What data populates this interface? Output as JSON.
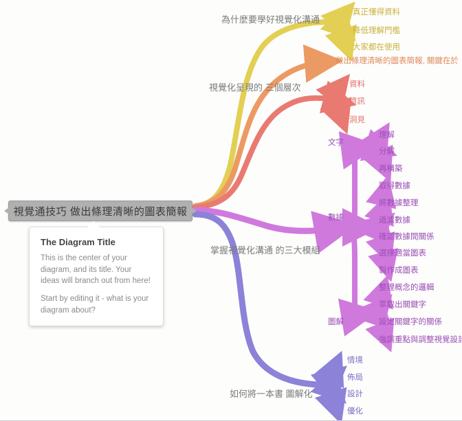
{
  "app": {
    "canvas_name": "mindmap-canvas",
    "background": "#fdfdfc"
  },
  "root": {
    "label": "視覺通技巧 做出條理清晰的圖表簡報",
    "color": "#b0b0b0"
  },
  "info_card": {
    "title": "The Diagram Title",
    "paragraph1": "This is the center of your diagram, and its title. Your ideas will branch out from here!",
    "paragraph2": "Start by editing it - what is your diagram about?"
  },
  "colors": {
    "yellow": "#e3cf53",
    "orange": "#ec9a64",
    "red": "#e97a72",
    "purple": "#cf79dd",
    "violet": "#8c82d8",
    "root_grey": "#b0b0b0"
  },
  "branches": [
    {
      "id": "why-visual-communication",
      "label": "為什麼要學好視覺化溝通",
      "color": "#e3cf53",
      "text_color": "#c9b23c",
      "children": [
        {
          "label": "真正懂得資料"
        },
        {
          "label": "降低理解門檻"
        },
        {
          "label": "大家都在使用"
        }
      ]
    },
    {
      "id": "clear-chart-key",
      "label": "做出條理清晰的圖表簡報, 關鍵在於「",
      "color": "#ec9a64",
      "text_color": "#e0885a",
      "children": []
    },
    {
      "id": "three-levels",
      "label": "視覺化呈現的 三個層次",
      "color": "#e97a72",
      "text_color": "#e0706a",
      "children": [
        {
          "label": "資料"
        },
        {
          "label": "資訊"
        },
        {
          "label": "洞見"
        }
      ]
    },
    {
      "id": "three-modules",
      "label": "掌握視覺化溝通 的三大模組",
      "color": "#cf79dd",
      "text_color": "#9a4fb5",
      "children": [
        {
          "label": "文字",
          "children": [
            {
              "label": "理解"
            },
            {
              "label": "分解"
            },
            {
              "label": "再構築"
            }
          ]
        },
        {
          "label": "數據",
          "children": [
            {
              "label": "取得數據"
            },
            {
              "label": "將數據整理"
            },
            {
              "label": "過濾數據"
            },
            {
              "label": "確認數據間關係"
            },
            {
              "label": "選擇適當圖表"
            },
            {
              "label": "製作成圖表"
            }
          ]
        },
        {
          "label": "圖解",
          "children": [
            {
              "label": "整理概念的邏輯"
            },
            {
              "label": "萃取出關鍵字"
            },
            {
              "label": "設定關鍵字的關係"
            },
            {
              "label": "強調重點與調整視覺設計"
            }
          ]
        }
      ]
    },
    {
      "id": "book-to-diagram",
      "label": "如何將一本書 圖解化",
      "color": "#8c82d8",
      "text_color": "#7b6fc4",
      "children": [
        {
          "label": "情境"
        },
        {
          "label": "佈局"
        },
        {
          "label": "設計"
        },
        {
          "label": "優化"
        }
      ]
    }
  ]
}
